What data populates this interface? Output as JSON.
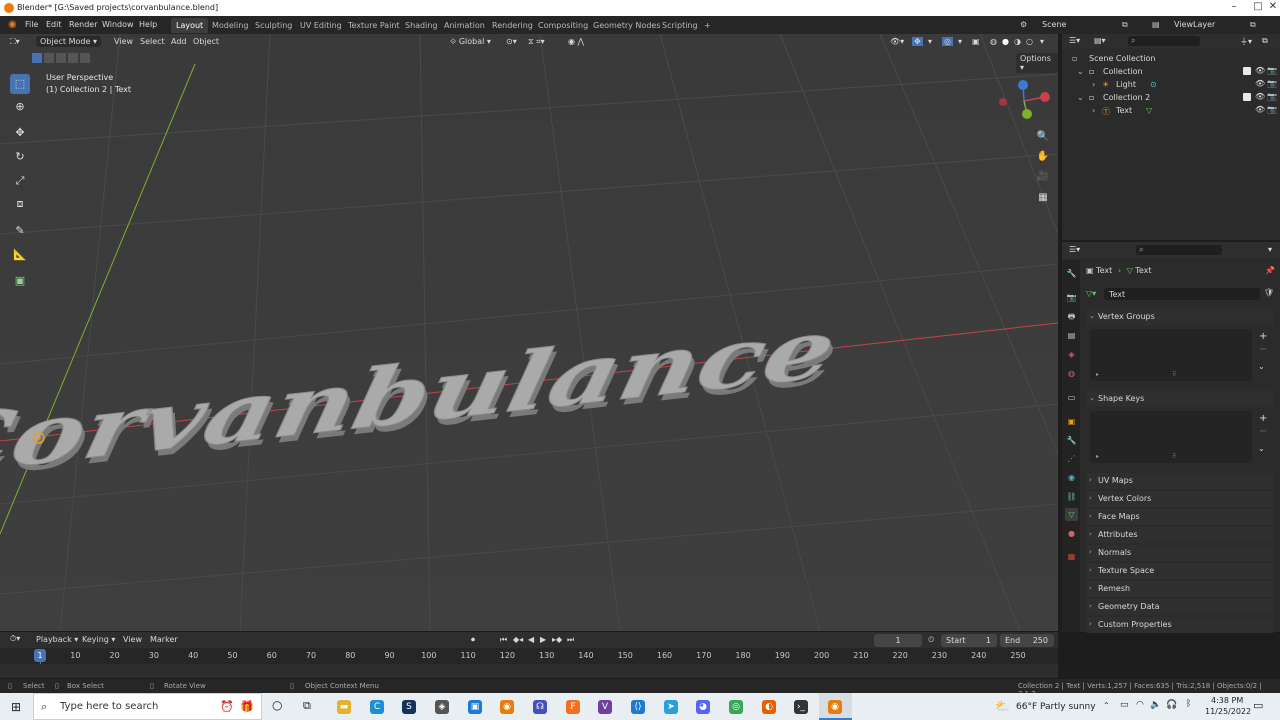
{
  "window": {
    "title": "Blender* [G:\\Saved projects\\corvanbulance.blend]",
    "controls": [
      "–",
      "□",
      "✕"
    ]
  },
  "menu": {
    "items": [
      "File",
      "Edit",
      "Render",
      "Window",
      "Help"
    ],
    "workspaces": [
      "Layout",
      "Modeling",
      "Sculpting",
      "UV Editing",
      "Texture Paint",
      "Shading",
      "Animation",
      "Rendering",
      "Compositing",
      "Geometry Nodes",
      "Scripting"
    ],
    "add_tab": "+",
    "scene": "Scene",
    "view_layer": "ViewLayer"
  },
  "viewport": {
    "mode": "Object Mode",
    "menus": [
      "View",
      "Select",
      "Add",
      "Object"
    ],
    "orientation": "Global",
    "options_label": "Options",
    "perspective": "User Perspective",
    "collection_info": "(1) Collection 2 | Text",
    "text_object": "Corvanbulance",
    "colors": {
      "bg": "#3c3c3c",
      "grid": "#4a4a4a",
      "x_axis": "#c8414b",
      "y_axis": "#7fb02a",
      "text_mesh": "#a9a9a9"
    }
  },
  "outliner": {
    "search_placeholder": "",
    "rows": [
      {
        "label": "Scene Collection",
        "indent": 0
      },
      {
        "label": "Collection",
        "indent": 1
      },
      {
        "label": "Light",
        "indent": 2
      },
      {
        "label": "Collection 2",
        "indent": 1
      },
      {
        "label": "Text",
        "indent": 2
      }
    ]
  },
  "properties": {
    "breadcrumb_1": "Text",
    "breadcrumb_2": "Text",
    "data_name": "Text",
    "panels": {
      "vertex_groups": "Vertex Groups",
      "shape_keys": "Shape Keys",
      "collapsed": [
        "UV Maps",
        "Vertex Colors",
        "Face Maps",
        "Attributes",
        "Normals",
        "Texture Space",
        "Remesh",
        "Geometry Data",
        "Custom Properties"
      ]
    }
  },
  "timeline": {
    "menus": [
      "Playback",
      "Keying",
      "View",
      "Marker"
    ],
    "current_frame": "1",
    "start_label": "Start",
    "start": "1",
    "end_label": "End",
    "end": "250",
    "ticks": [
      "1",
      "10",
      "20",
      "30",
      "40",
      "50",
      "60",
      "70",
      "80",
      "90",
      "100",
      "110",
      "120",
      "130",
      "140",
      "150",
      "160",
      "170",
      "180",
      "190",
      "200",
      "210",
      "220",
      "230",
      "240",
      "250"
    ]
  },
  "statusbar": {
    "select": "Select",
    "box_select": "Box Select",
    "rotate_view": "Rotate View",
    "context_menu": "Object Context Menu",
    "stats": "Collection 2 | Text | Verts:1,257 | Faces:635 | Tris:2,518 | Objects:0/2 | 3.1.2"
  },
  "taskbar": {
    "search_placeholder": "Type here to search",
    "weather": "66°F  Partly sunny",
    "time": "4:38 PM",
    "date": "11/25/2022"
  }
}
